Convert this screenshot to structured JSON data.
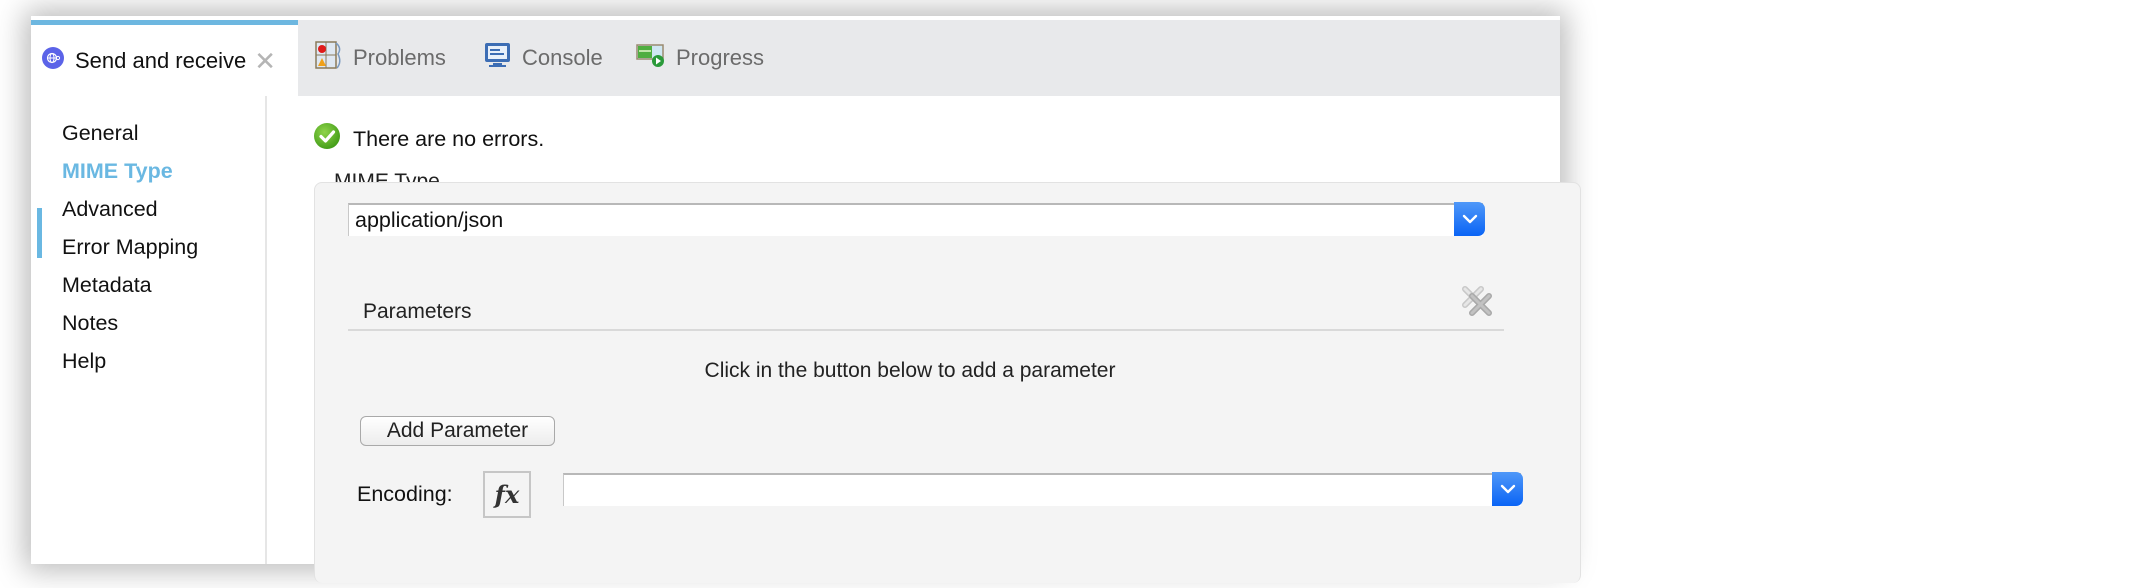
{
  "tabs": [
    {
      "label": "Send and receive",
      "icon": "globe-connector-icon",
      "active": true,
      "closable": true
    },
    {
      "label": "Problems",
      "icon": "problems-icon",
      "active": false
    },
    {
      "label": "Console",
      "icon": "console-monitor-icon",
      "active": false
    },
    {
      "label": "Progress",
      "icon": "progress-icon",
      "active": false
    }
  ],
  "sidebar": {
    "items": [
      {
        "label": "General"
      },
      {
        "label": "MIME Type",
        "active": true
      },
      {
        "label": "Advanced"
      },
      {
        "label": "Error Mapping"
      },
      {
        "label": "Metadata"
      },
      {
        "label": "Notes"
      },
      {
        "label": "Help"
      }
    ]
  },
  "status": {
    "icon": "success-check-icon",
    "text": "There are no errors."
  },
  "mime": {
    "section_label": "MIME Type",
    "mime_type_value": "application/json",
    "parameters_title": "Parameters",
    "parameters_hint": "Click in the button below to add a parameter",
    "add_parameter_label": "Add Parameter",
    "encoding_label": "Encoding:",
    "encoding_value": "",
    "fx_label": "fx"
  },
  "colors": {
    "accent": "#6ab8e2",
    "dropdown_button": "#1a6ff6",
    "tabbar_bg": "#e8e9eb",
    "panel_bg": "#f4f4f4"
  }
}
